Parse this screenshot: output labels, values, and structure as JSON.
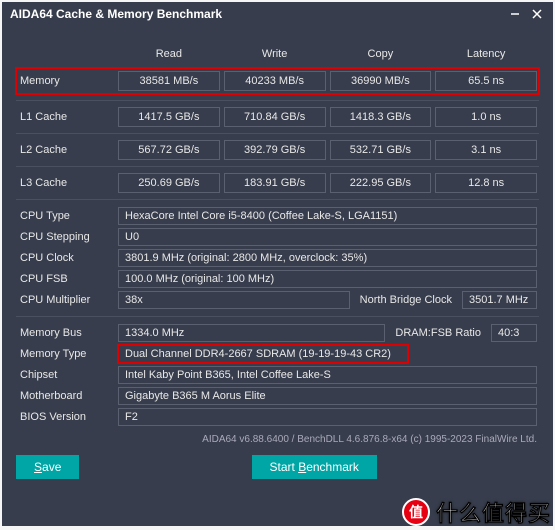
{
  "window": {
    "title": "AIDA64 Cache & Memory Benchmark"
  },
  "headers": {
    "read": "Read",
    "write": "Write",
    "copy": "Copy",
    "latency": "Latency"
  },
  "rows": {
    "memory": {
      "label": "Memory",
      "read": "38581 MB/s",
      "write": "40233 MB/s",
      "copy": "36990 MB/s",
      "lat": "65.5 ns"
    },
    "l1": {
      "label": "L1 Cache",
      "read": "1417.5 GB/s",
      "write": "710.84 GB/s",
      "copy": "1418.3 GB/s",
      "lat": "1.0 ns"
    },
    "l2": {
      "label": "L2 Cache",
      "read": "567.72 GB/s",
      "write": "392.79 GB/s",
      "copy": "532.71 GB/s",
      "lat": "3.1 ns"
    },
    "l3": {
      "label": "L3 Cache",
      "read": "250.69 GB/s",
      "write": "183.91 GB/s",
      "copy": "222.95 GB/s",
      "lat": "12.8 ns"
    }
  },
  "info": {
    "cpu_type": {
      "label": "CPU Type",
      "val": "HexaCore Intel Core i5-8400  (Coffee Lake-S, LGA1151)"
    },
    "cpu_stepping": {
      "label": "CPU Stepping",
      "val": "U0"
    },
    "cpu_clock": {
      "label": "CPU Clock",
      "val": "3801.9 MHz  (original: 2800 MHz, overclock: 35%)"
    },
    "cpu_fsb": {
      "label": "CPU FSB",
      "val": "100.0 MHz  (original: 100 MHz)"
    },
    "cpu_mult": {
      "label": "CPU Multiplier",
      "val": "38x",
      "nb_label": "North Bridge Clock",
      "nb_val": "3501.7 MHz"
    },
    "mem_bus": {
      "label": "Memory Bus",
      "val": "1334.0 MHz",
      "ratio_label": "DRAM:FSB Ratio",
      "ratio_val": "40:3"
    },
    "mem_type": {
      "label": "Memory Type",
      "val": "Dual Channel DDR4-2667 SDRAM  (19-19-19-43 CR2)"
    },
    "chipset": {
      "label": "Chipset",
      "val": "Intel Kaby Point B365, Intel Coffee Lake-S"
    },
    "mobo": {
      "label": "Motherboard",
      "val": "Gigabyte B365 M Aorus Elite"
    },
    "bios": {
      "label": "BIOS Version",
      "val": "F2"
    }
  },
  "footer": "AIDA64 v6.88.6400 / BenchDLL 4.6.876.8-x64  (c) 1995-2023 FinalWire Ltd.",
  "buttons": {
    "save_u": "S",
    "save_rest": "ave",
    "start_pre": "Start ",
    "start_u": "B",
    "start_rest": "enchmark"
  },
  "watermark": {
    "badge": "值",
    "text": "什么值得买"
  }
}
